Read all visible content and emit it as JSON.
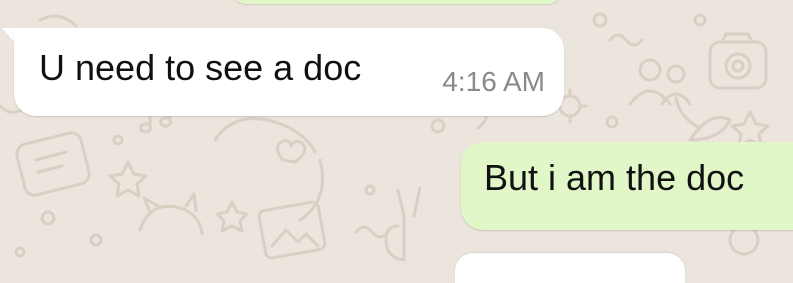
{
  "chat": {
    "wallpaper_color": "#ece5dd",
    "doodle_color": "#d9d0c4",
    "incoming_bubble_color": "#ffffff",
    "outgoing_bubble_color": "#e1f7c8",
    "messages": [
      {
        "direction": "incoming",
        "text": "U need to see a doc",
        "time": "4:16 AM"
      },
      {
        "direction": "outgoing",
        "text": "But i am the doc"
      }
    ]
  }
}
